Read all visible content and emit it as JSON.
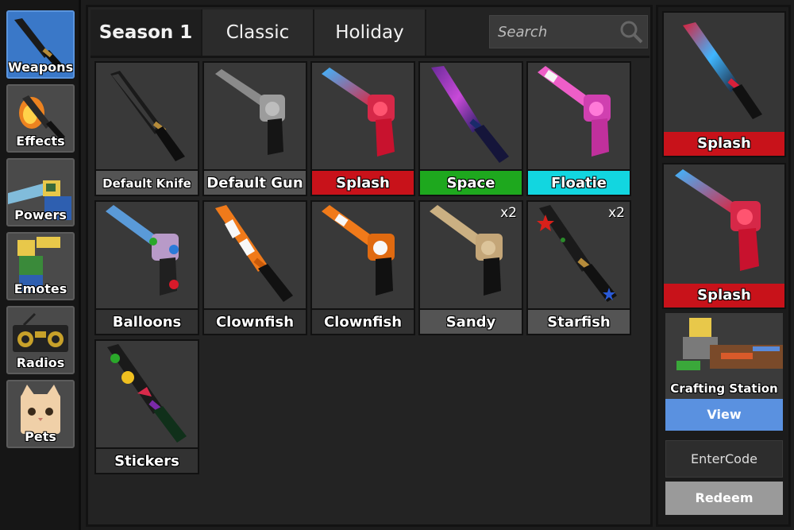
{
  "sidebar": {
    "items": [
      {
        "label": "Weapons",
        "icon": "knife-icon",
        "active": true
      },
      {
        "label": "Effects",
        "icon": "flame-knife-icon"
      },
      {
        "label": "Powers",
        "icon": "power-character-icon"
      },
      {
        "label": "Emotes",
        "icon": "emote-character-icon"
      },
      {
        "label": "Radios",
        "icon": "boombox-icon"
      },
      {
        "label": "Pets",
        "icon": "cat-pet-icon"
      }
    ]
  },
  "tabs": [
    {
      "label": "Season 1",
      "active": true
    },
    {
      "label": "Classic"
    },
    {
      "label": "Holiday"
    }
  ],
  "search": {
    "placeholder": "Search",
    "value": ""
  },
  "items": [
    {
      "name": "Default Knife",
      "type": "knife",
      "rarity_color": "#545454",
      "art": "default-knife-icon"
    },
    {
      "name": "Default Gun",
      "type": "gun",
      "rarity_color": "#545454",
      "art": "default-gun-icon"
    },
    {
      "name": "Splash",
      "type": "gun",
      "rarity_color": "#c8121a",
      "art": "splash-gun-icon"
    },
    {
      "name": "Space",
      "type": "knife",
      "rarity_color": "#1ea81e",
      "art": "space-knife-icon"
    },
    {
      "name": "Floatie",
      "type": "gun",
      "rarity_color": "#12d6e0",
      "art": "floatie-gun-icon"
    },
    {
      "name": "Balloons",
      "type": "gun",
      "rarity_color": "#545454",
      "art": "balloons-gun-icon"
    },
    {
      "name": "Clownfish",
      "type": "knife",
      "rarity_color": "#545454",
      "art": "clownfish-knife-icon"
    },
    {
      "name": "Clownfish",
      "type": "gun",
      "rarity_color": "#545454",
      "art": "clownfish-gun-icon"
    },
    {
      "name": "Sandy",
      "type": "gun",
      "rarity_color": "#545454",
      "art": "sandy-gun-icon",
      "qty": "x2"
    },
    {
      "name": "Starfish",
      "type": "knife",
      "rarity_color": "#545454",
      "art": "starfish-knife-icon",
      "qty": "x2"
    },
    {
      "name": "Stickers",
      "type": "knife",
      "rarity_color": "#545454",
      "art": "stickers-knife-icon"
    }
  ],
  "equipped": [
    {
      "name": "Splash",
      "type": "knife",
      "rarity_color": "#c8121a",
      "art": "splash-knife-icon"
    },
    {
      "name": "Splash",
      "type": "gun",
      "rarity_color": "#c8121a",
      "art": "splash-gun-icon"
    }
  ],
  "crafting": {
    "label": "Crafting Station",
    "button": "View"
  },
  "code": {
    "placeholder": "EnterCode",
    "button": "Redeem"
  }
}
